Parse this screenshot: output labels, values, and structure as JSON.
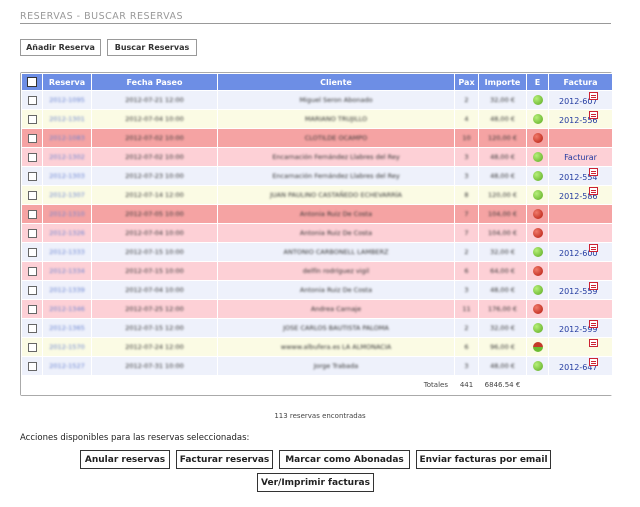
{
  "page": {
    "title": "RESERVAS - BUSCAR RESERVAS"
  },
  "toolbar": {
    "add_label": "Añadir Reserva",
    "search_label": "Buscar Reservas"
  },
  "table": {
    "columns": [
      "",
      "Reserva",
      "Fecha Paseo",
      "Cliente",
      "Pax",
      "Importe",
      "E",
      "Factura"
    ],
    "rows": [
      {
        "reserva": "2012-1095",
        "fecha": "2012-07-21 12:00",
        "cliente": "Miguel Seron Abonado",
        "pax": "2",
        "importe": "32,00 €",
        "estado": "green",
        "factura": "2012-607",
        "pdf": true,
        "tone": "white"
      },
      {
        "reserva": "2012-1301",
        "fecha": "2012-07-04 10:00",
        "cliente": "MARIANO TRUJILLO",
        "pax": "4",
        "importe": "48,00 €",
        "estado": "green",
        "factura": "2012-556",
        "pdf": true,
        "tone": "yellow"
      },
      {
        "reserva": "2012-1083",
        "fecha": "2012-07-02 10:00",
        "cliente": "CLOTILDE OCAMPO",
        "pax": "10",
        "importe": "120,00 €",
        "estado": "red",
        "factura": "",
        "pdf": false,
        "tone": "red"
      },
      {
        "reserva": "2012-1302",
        "fecha": "2012-07-02 10:00",
        "cliente": "Encarnación Fernández Llabres del Rey",
        "pax": "3",
        "importe": "48,00 €",
        "estado": "green",
        "factura": "Facturar",
        "pdf": false,
        "tone": "pink"
      },
      {
        "reserva": "2012-1303",
        "fecha": "2012-07-23 10:00",
        "cliente": "Encarnación Fernández Llabres del Rey",
        "pax": "3",
        "importe": "48,00 €",
        "estado": "green",
        "factura": "2012-554",
        "pdf": true,
        "tone": "white"
      },
      {
        "reserva": "2012-1307",
        "fecha": "2012-07-14 12:00",
        "cliente": "JUAN PAULINO CASTAÑEDO ECHEVARRÍA",
        "pax": "8",
        "importe": "120,00 €",
        "estado": "green",
        "factura": "2012-586",
        "pdf": true,
        "tone": "yellow"
      },
      {
        "reserva": "2012-1310",
        "fecha": "2012-07-05 10:00",
        "cliente": "Antonia Ruiz De Costa",
        "pax": "7",
        "importe": "104,00 €",
        "estado": "red",
        "factura": "",
        "pdf": false,
        "tone": "red"
      },
      {
        "reserva": "2012-1326",
        "fecha": "2012-07-04 10:00",
        "cliente": "Antonia Ruiz De Costa",
        "pax": "7",
        "importe": "104,00 €",
        "estado": "red",
        "factura": "",
        "pdf": false,
        "tone": "pink"
      },
      {
        "reserva": "2012-1333",
        "fecha": "2012-07-15 10:00",
        "cliente": "ANTONIO CARBONELL LAMBERZ",
        "pax": "2",
        "importe": "32,00 €",
        "estado": "green",
        "factura": "2012-600",
        "pdf": true,
        "tone": "white"
      },
      {
        "reserva": "2012-1334",
        "fecha": "2012-07-15 10:00",
        "cliente": "delfín rodríguez vigil",
        "pax": "6",
        "importe": "64,00 €",
        "estado": "red",
        "factura": "",
        "pdf": false,
        "tone": "pink"
      },
      {
        "reserva": "2012-1339",
        "fecha": "2012-07-04 10:00",
        "cliente": "Antonia Ruiz De Costa",
        "pax": "3",
        "importe": "48,00 €",
        "estado": "green",
        "factura": "2012-559",
        "pdf": true,
        "tone": "white"
      },
      {
        "reserva": "2012-1346",
        "fecha": "2012-07-25 12:00",
        "cliente": "Andrea Carnaje",
        "pax": "11",
        "importe": "176,00 €",
        "estado": "red",
        "factura": "",
        "pdf": false,
        "tone": "pink"
      },
      {
        "reserva": "2012-1365",
        "fecha": "2012-07-15 12:00",
        "cliente": "JOSE CARLOS BAUTISTA PALOMA",
        "pax": "2",
        "importe": "32,00 €",
        "estado": "green",
        "factura": "2012-599",
        "pdf": true,
        "tone": "white"
      },
      {
        "reserva": "2012-1570",
        "fecha": "2012-07-24 12:00",
        "cliente": "wwww.albufera.es LA ALMONACIA",
        "pax": "6",
        "importe": "96,00 €",
        "estado": "mixed",
        "factura": "",
        "pdf": true,
        "tone": "yellow"
      },
      {
        "reserva": "2012-1527",
        "fecha": "2012-07-31 10:00",
        "cliente": "Jorge Trabada",
        "pax": "3",
        "importe": "48,00 €",
        "estado": "green",
        "factura": "2012-647",
        "pdf": true,
        "tone": "white"
      }
    ],
    "totals": {
      "label": "Totales",
      "pax": "441",
      "importe": "6846.54 €"
    }
  },
  "found_text": "113 reservas encontradas",
  "actions": {
    "label": "Acciones disponibles para las reservas seleccionadas:",
    "anular": "Anular reservas",
    "facturar": "Facturar reservas",
    "abonadas": "Marcar como Abonadas",
    "enviar": "Enviar facturas por email",
    "imprimir": "Ver/Imprimir facturas"
  }
}
